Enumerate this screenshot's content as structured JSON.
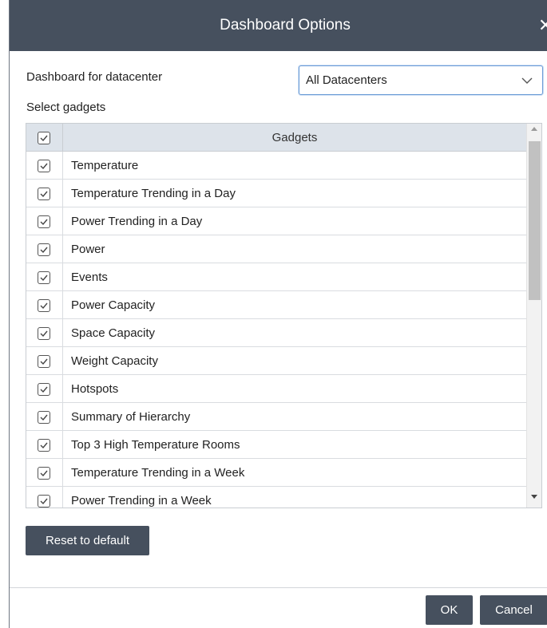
{
  "dialog": {
    "title": "Dashboard Options",
    "close_glyph": "✕"
  },
  "datacenter": {
    "label": "Dashboard for datacenter",
    "selected": "All Datacenters"
  },
  "gadgets": {
    "label": "Select gadgets",
    "header": "Gadgets",
    "header_checked": true,
    "rows": [
      {
        "label": "Temperature",
        "checked": true
      },
      {
        "label": "Temperature Trending in a Day",
        "checked": true
      },
      {
        "label": "Power Trending in a Day",
        "checked": true
      },
      {
        "label": "Power",
        "checked": true
      },
      {
        "label": "Events",
        "checked": true
      },
      {
        "label": "Power Capacity",
        "checked": true
      },
      {
        "label": "Space Capacity",
        "checked": true
      },
      {
        "label": "Weight Capacity",
        "checked": true
      },
      {
        "label": "Hotspots",
        "checked": true
      },
      {
        "label": "Summary of Hierarchy",
        "checked": true
      },
      {
        "label": "Top 3 High Temperature Rooms",
        "checked": true
      },
      {
        "label": "Temperature Trending in a Week",
        "checked": true
      },
      {
        "label": "Power Trending in a Week",
        "checked": true
      }
    ]
  },
  "buttons": {
    "reset": "Reset to default",
    "ok": "OK",
    "cancel": "Cancel"
  },
  "colors": {
    "titlebar": "#46505e",
    "button": "#46505e",
    "header_bg": "#dde3ea",
    "select_border": "#6a9bd6"
  }
}
